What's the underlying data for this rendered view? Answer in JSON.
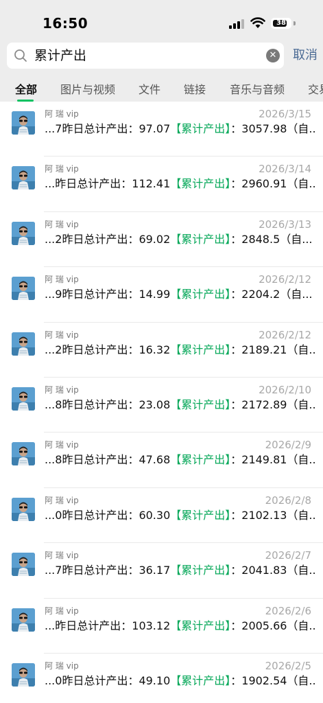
{
  "status_bar": {
    "time": "16:50",
    "battery": "38"
  },
  "search": {
    "value": "累计产出",
    "cancel_label": "取消"
  },
  "tabs": [
    "全部",
    "图片与视频",
    "文件",
    "链接",
    "音乐与音频",
    "交易"
  ],
  "results": [
    {
      "sender": "阿 瑞 vip",
      "date": "2026/3/15",
      "prefix": "...7昨日总计产出：97.07",
      "highlight": "【累计产出】",
      "suffix": "：3057.98（自..."
    },
    {
      "sender": "阿 瑞 vip",
      "date": "2026/3/14",
      "prefix": "...昨日总计产出：112.41",
      "highlight": "【累计产出】",
      "suffix": "：2960.91（自..."
    },
    {
      "sender": "阿 瑞 vip",
      "date": "2026/3/13",
      "prefix": "...2昨日总计产出：69.02",
      "highlight": "【累计产出】",
      "suffix": "：2848.5（自..."
    },
    {
      "sender": "阿 瑞 vip",
      "date": "2026/2/12",
      "prefix": "...9昨日总计产出：14.99",
      "highlight": "【累计产出】",
      "suffix": "：2204.2（自..."
    },
    {
      "sender": "阿 瑞 vip",
      "date": "2026/2/12",
      "prefix": "...2昨日总计产出：16.32",
      "highlight": "【累计产出】",
      "suffix": "：2189.21（自..."
    },
    {
      "sender": "阿 瑞 vip",
      "date": "2026/2/10",
      "prefix": "...8昨日总计产出：23.08",
      "highlight": "【累计产出】",
      "suffix": "：2172.89（自..."
    },
    {
      "sender": "阿 瑞 vip",
      "date": "2026/2/9",
      "prefix": "...8昨日总计产出：47.68",
      "highlight": "【累计产出】",
      "suffix": "：2149.81（自..."
    },
    {
      "sender": "阿 瑞 vip",
      "date": "2026/2/8",
      "prefix": "...0昨日总计产出：60.30",
      "highlight": "【累计产出】",
      "suffix": "：2102.13（自..."
    },
    {
      "sender": "阿 瑞 vip",
      "date": "2026/2/7",
      "prefix": "...7昨日总计产出：36.17",
      "highlight": "【累计产出】",
      "suffix": "：2041.83（自..."
    },
    {
      "sender": "阿 瑞 vip",
      "date": "2026/2/6",
      "prefix": "...昨日总计产出：103.12",
      "highlight": "【累计产出】",
      "suffix": "：2005.66（自..."
    },
    {
      "sender": "阿 瑞 vip",
      "date": "2026/2/5",
      "prefix": "...0昨日总计产出：49.10",
      "highlight": "【累计产出】",
      "suffix": "：1902.54（自..."
    }
  ],
  "colors": {
    "accent_green": "#07c160",
    "highlight_green": "#07a85a",
    "link_blue": "#4a6a94",
    "header_bg": "#ededed"
  },
  "icons": {
    "search": "search-icon",
    "clear": "clear-icon",
    "signal": "signal-icon",
    "wifi": "wifi-icon",
    "battery": "battery-icon",
    "avatar": "avatar"
  }
}
